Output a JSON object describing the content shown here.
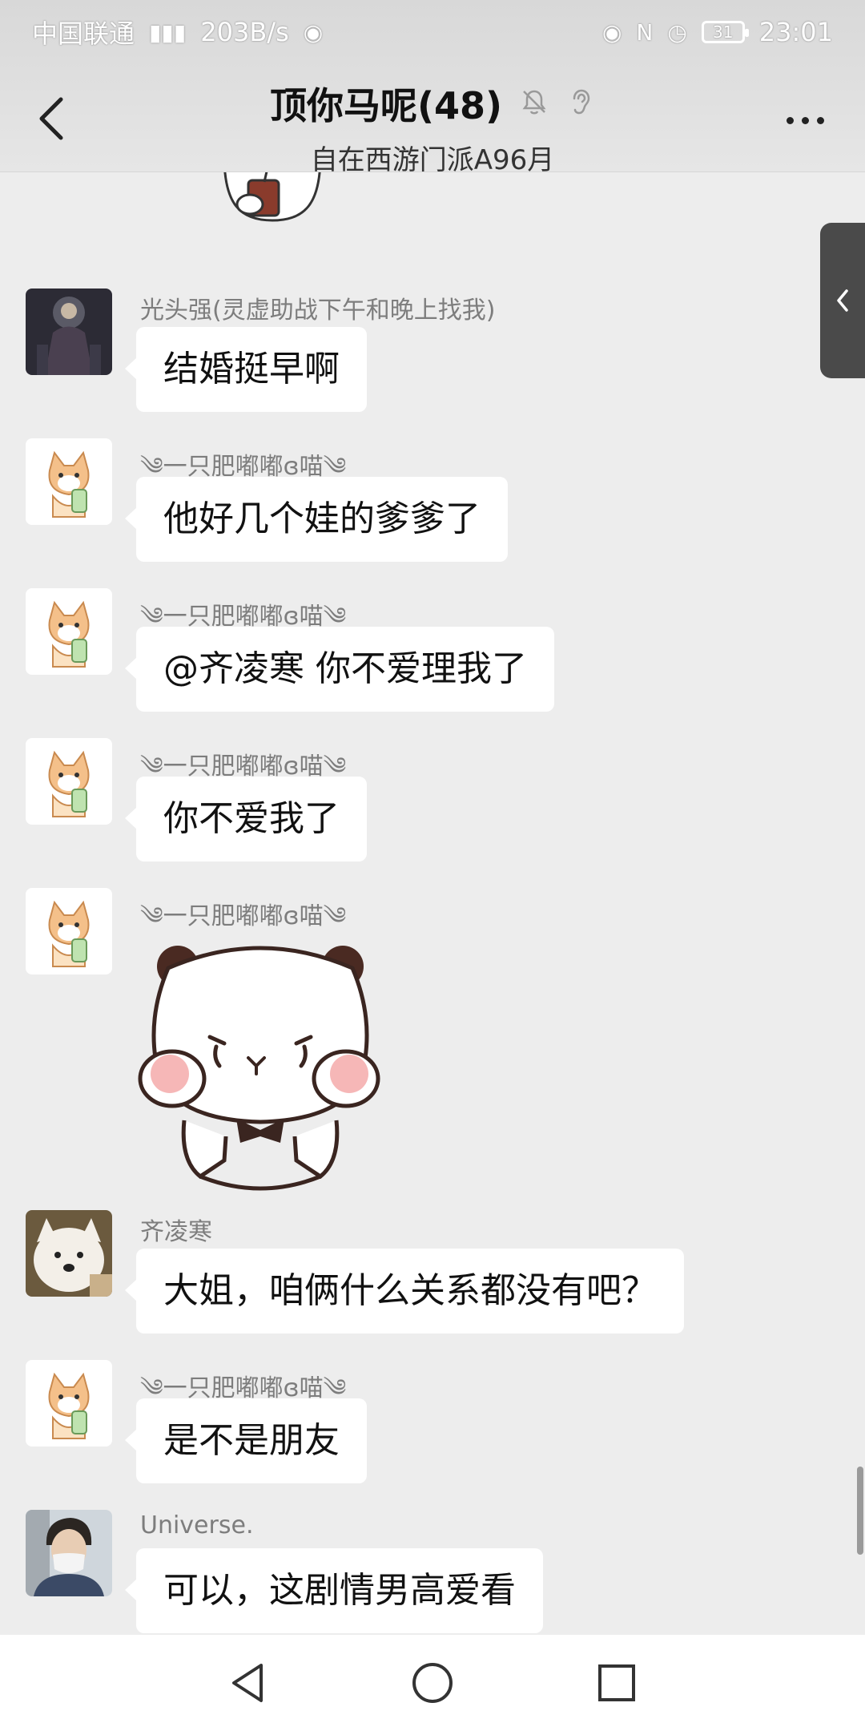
{
  "status_bar": {
    "carrier": "中国联通",
    "network_speed": "203B/s",
    "time": "23:01",
    "battery": "31"
  },
  "header": {
    "title": "顶你马呢(48)",
    "subtitle": "自在西游门派A96月"
  },
  "messages": [
    {
      "sender": "光头强(灵虚助战下午和晚上找我)",
      "text": "结婚挺早啊",
      "avatar": "dark-figure"
    },
    {
      "sender": "༄一只肥嘟嘟ɞ喵༄",
      "text": "他好几个娃的爹爹了",
      "avatar": "cat"
    },
    {
      "sender": "༄一只肥嘟嘟ɞ喵༄",
      "text": "@齐凌寒  你不爱理我了",
      "avatar": "cat"
    },
    {
      "sender": "༄一只肥嘟嘟ɞ喵༄",
      "text": "你不爱我了",
      "avatar": "cat"
    },
    {
      "sender": "༄一只肥嘟嘟ɞ喵༄",
      "sticker": "panda-bear-sticker",
      "avatar": "cat"
    },
    {
      "sender": "齐凌寒",
      "text": "大姐，咱俩什么关系都没有吧？",
      "avatar": "white-dog"
    },
    {
      "sender": "༄一只肥嘟嘟ɞ喵༄",
      "text": "是不是朋友",
      "avatar": "cat"
    },
    {
      "sender": "Universe.",
      "text": "可以，这剧情男高爱看",
      "avatar": "person-mask"
    }
  ],
  "icons": {
    "back": "back-arrow-icon",
    "mute": "bell-off-icon",
    "ear": "ear-icon",
    "more": "more-dots-icon",
    "side_handle": "chevron-left-icon",
    "nav_back": "nav-back-icon",
    "nav_home": "nav-home-icon",
    "nav_recent": "nav-recent-icon"
  },
  "colors": {
    "background": "#ededed",
    "bubble": "#ffffff",
    "sender_name": "#7d7d7d"
  }
}
